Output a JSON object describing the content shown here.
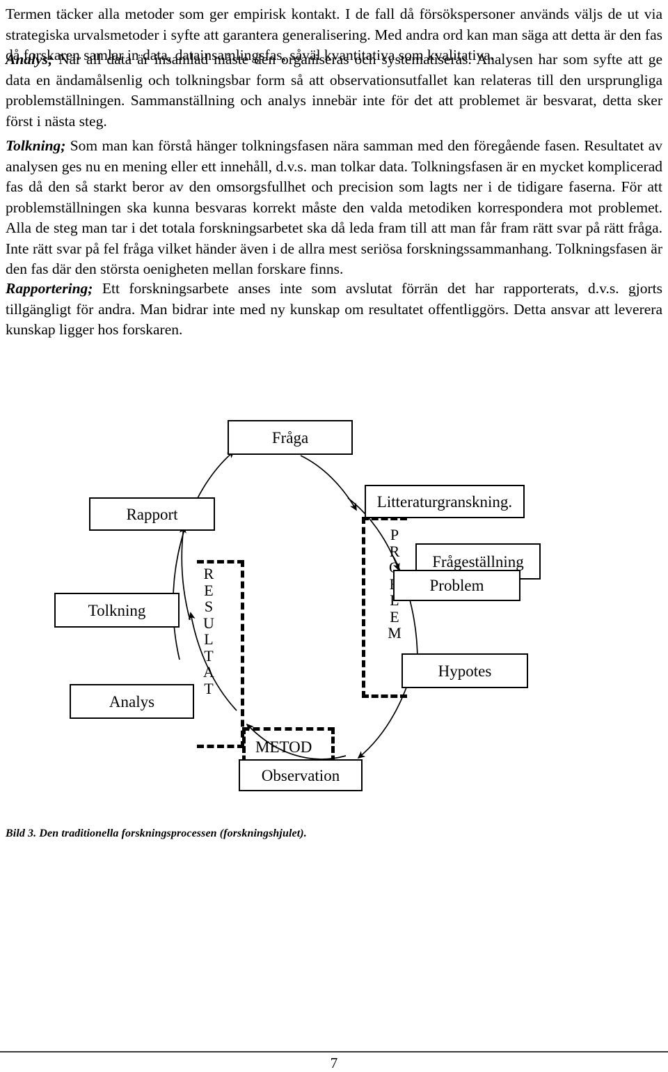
{
  "document": {
    "page_number": "7",
    "paragraphs": [
      {
        "id": "p-datainsamling",
        "lead": "",
        "text": "Termen täcker alla metoder som ger empirisk kontakt. I de fall då försökspersoner används väljs de ut via strategiska urvalsmetoder i syfte att garantera generalisering. Med andra ord kan man säga att detta är den fas då forskaren samlar in data, datainsamlingsfas, såväl kvantitativa som kvalitativa."
      },
      {
        "id": "p-analys",
        "lead": "Analys;",
        "text": " När all data är insamlad måste den organiseras och systematiseras. Analysen har som syfte att ge data en ändamålsenlig och tolkningsbar form så att observationsutfallet kan relateras till den ursprungliga problemställningen. Sammanställning och analys innebär inte för det att problemet är besvarat, detta sker först i nästa steg."
      },
      {
        "id": "p-tolkning",
        "lead": "Tolkning;",
        "text": " Som man kan förstå hänger tolkningsfasen nära samman med den föregående fasen. Resultatet av analysen ges nu en mening eller ett innehåll, d.v.s. man tolkar data. Tolkningsfasen är en mycket komplicerad fas då den så starkt beror av den omsorgsfullhet och precision som lagts ner i de tidigare faserna. För att problemställningen ska kunna besvaras korrekt måste den valda metodiken korrespondera mot problemet. Alla de steg man tar i det totala forskningsarbetet ska då leda fram till att man får fram rätt svar på rätt fråga. Inte rätt svar på fel fråga vilket händer även i de allra mest seriösa forskningssammanhang. Tolkningsfasen är den fas där den största oenigheten mellan forskare finns."
      },
      {
        "id": "p-rapportering",
        "lead": "Rapportering;",
        "text": " Ett forskningsarbete anses inte som avslutat förrän det har rapporterats, d.v.s. gjorts tillgängligt för andra. Man bidrar inte med ny kunskap om resultatet offentliggörs. Detta ansvar att leverera kunskap ligger hos forskaren."
      }
    ],
    "figure": {
      "caption": "Bild 3. Den traditionella forskningsprocessen (forskningshjulet).",
      "nodes": {
        "fraga": "Fråga",
        "litteraturgranskning": "Litteraturgranskning.",
        "fragestallning": "Frågeställning",
        "problem": "Problem",
        "hypotes": "Hypotes",
        "observation": "Observation",
        "analys": "Analys",
        "tolkning": "Tolkning",
        "rapport": "Rapport",
        "metod": "METOD"
      },
      "vertical_labels": {
        "resultat": "R\nE\nS\nU\nL\nT\nA\nT",
        "problem": "P\nR\nO\nB\nL\nE\nM"
      },
      "colors": {
        "stroke": "#000000",
        "background": "#ffffff"
      }
    }
  }
}
